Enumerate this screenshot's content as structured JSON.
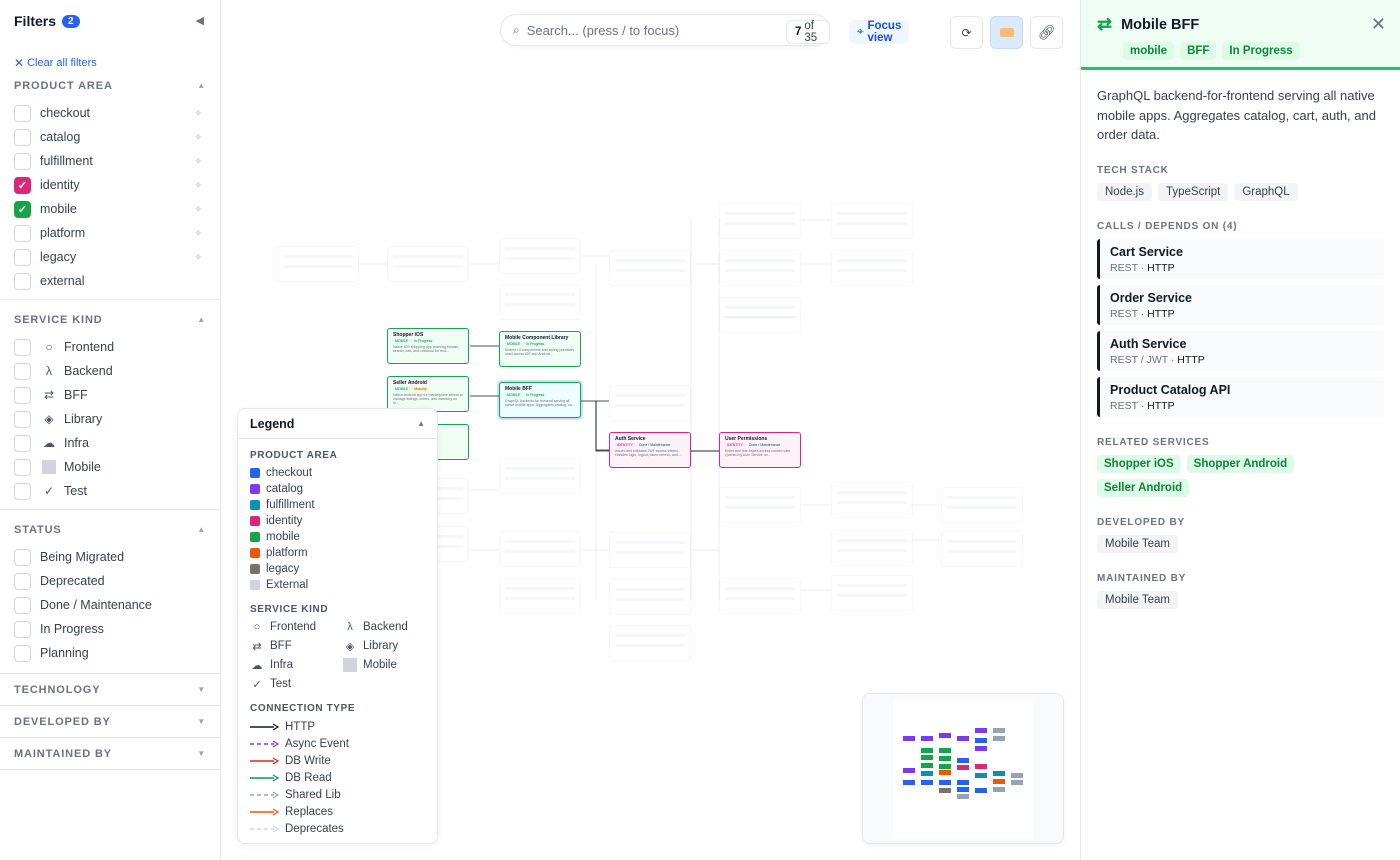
{
  "sidebar": {
    "title": "Filters",
    "badge": "2",
    "collapse_icon": "◀",
    "clear_all": "Clear all filters",
    "product_area": {
      "title": "PRODUCT AREA",
      "options": [
        {
          "label": "checkout",
          "checked": false
        },
        {
          "label": "catalog",
          "checked": false
        },
        {
          "label": "fulfillment",
          "checked": false
        },
        {
          "label": "identity",
          "checked": true,
          "color": "#db2777"
        },
        {
          "label": "mobile",
          "checked": true,
          "color": "#16a34a"
        },
        {
          "label": "platform",
          "checked": false
        },
        {
          "label": "legacy",
          "checked": false
        },
        {
          "label": "external",
          "checked": false
        }
      ]
    },
    "service_kind": {
      "title": "SERVICE KIND",
      "options": [
        {
          "label": "Frontend",
          "icon": "○"
        },
        {
          "label": "Backend",
          "icon": "λ"
        },
        {
          "label": "BFF",
          "icon": "⇄"
        },
        {
          "label": "Library",
          "icon": "◈"
        },
        {
          "label": "Infra",
          "icon": "☁"
        },
        {
          "label": "Mobile",
          "icon": ""
        },
        {
          "label": "Test",
          "icon": "✓"
        }
      ]
    },
    "status": {
      "title": "STATUS",
      "options": [
        "Being Migrated",
        "Deprecated",
        "Done / Maintenance",
        "In Progress",
        "Planning"
      ]
    },
    "collapsed": [
      "TECHNOLOGY",
      "DEVELOPED BY",
      "MAINTAINED BY"
    ]
  },
  "toolbar": {
    "search_placeholder": "Search... (press / to focus)",
    "count_current": "7",
    "count_rest": "of 35",
    "focus_label": "Focus view"
  },
  "graph": {
    "nodes": [
      {
        "title": "Shopper iOS",
        "badge1": "MOBILE",
        "badge2": "In Progress",
        "desc": "Native iOS shopping app covering browse, search, cart, and checkout for end..."
      },
      {
        "title": "Seller Android",
        "badge1": "MOBILE",
        "badge2": "Maturity",
        "desc": "Native Android app for marketplace sellers to manage listings, orders, and inventory on th..."
      },
      {
        "title": "Mobile Component Library",
        "badge1": "MOBILE",
        "badge2": "In Progress",
        "desc": "Shared UI components and styling primitives used across iOS and Android..."
      },
      {
        "title": "Mobile BFF",
        "badge1": "MOBILE",
        "badge2": "In Progress",
        "desc": "GraphQL backend-for-frontend serving all native mobile apps. Aggregates catalog, ca..."
      },
      {
        "title": "Auth Service",
        "badge1": "IDENTITY",
        "badge2": "Done / Maintenance",
        "desc": "Issues and validates JWT access tokens. Handles login, logout, token refresh, and..."
      },
      {
        "title": "User Permissions",
        "badge1": "IDENTITY",
        "badge2": "Done / Maintenance",
        "desc": "Roles and role-based access control rules. Queried by Auth Service on..."
      }
    ]
  },
  "legend": {
    "title": "Legend",
    "product_area_title": "PRODUCT AREA",
    "product_areas": [
      {
        "label": "checkout",
        "color": "#2563eb"
      },
      {
        "label": "catalog",
        "color": "#7c3aed"
      },
      {
        "label": "fulfillment",
        "color": "#0891b2"
      },
      {
        "label": "identity",
        "color": "#db2777"
      },
      {
        "label": "mobile",
        "color": "#16a34a"
      },
      {
        "label": "platform",
        "color": "#ea580c"
      },
      {
        "label": "legacy",
        "color": "#78716c"
      },
      {
        "label": "External",
        "color": "#cbd5e1"
      }
    ],
    "service_kind_title": "SERVICE KIND",
    "service_kinds": [
      {
        "label": "Frontend",
        "icon": "○"
      },
      {
        "label": "Backend",
        "icon": "λ"
      },
      {
        "label": "BFF",
        "icon": "⇄"
      },
      {
        "label": "Library",
        "icon": "◈"
      },
      {
        "label": "Infra",
        "icon": "☁"
      },
      {
        "label": "Mobile",
        "icon": ""
      },
      {
        "label": "Test",
        "icon": "✓"
      }
    ],
    "connection_title": "CONNECTION TYPE",
    "connections": [
      {
        "label": "HTTP",
        "color": "#111827",
        "dash": ""
      },
      {
        "label": "Async Event",
        "color": "#7c3aed",
        "dash": "4 3"
      },
      {
        "label": "DB Write",
        "color": "#dc2626",
        "dash": ""
      },
      {
        "label": "DB Read",
        "color": "#059669",
        "dash": ""
      },
      {
        "label": "Shared Lib",
        "color": "#94a3b8",
        "dash": "4 3"
      },
      {
        "label": "Replaces",
        "color": "#ea580c",
        "dash": ""
      },
      {
        "label": "Deprecates",
        "color": "#cbd5e1",
        "dash": "4 3"
      }
    ]
  },
  "details": {
    "title": "Mobile BFF",
    "tags": [
      "mobile",
      "BFF",
      "In Progress"
    ],
    "description": "GraphQL backend-for-frontend serving all native mobile apps. Aggregates catalog, cart, auth, and order data.",
    "tech_stack_title": "TECH STACK",
    "tech_stack": [
      "Node.js",
      "TypeScript",
      "GraphQL"
    ],
    "calls_title": "CALLS / DEPENDS ON (4)",
    "calls": [
      {
        "name": "Cart Service",
        "proto": "REST",
        "type": "HTTP"
      },
      {
        "name": "Order Service",
        "proto": "REST",
        "type": "HTTP"
      },
      {
        "name": "Auth Service",
        "proto": "REST / JWT",
        "type": "HTTP"
      },
      {
        "name": "Product Catalog API",
        "proto": "REST",
        "type": "HTTP"
      }
    ],
    "related_title": "RELATED SERVICES",
    "related": [
      "Shopper iOS",
      "Shopper Android",
      "Seller Android"
    ],
    "developed_title": "DEVELOPED BY",
    "developed": "Mobile Team",
    "maintained_title": "MAINTAINED BY",
    "maintained": "Mobile Team",
    "accent": "#16a34a"
  }
}
